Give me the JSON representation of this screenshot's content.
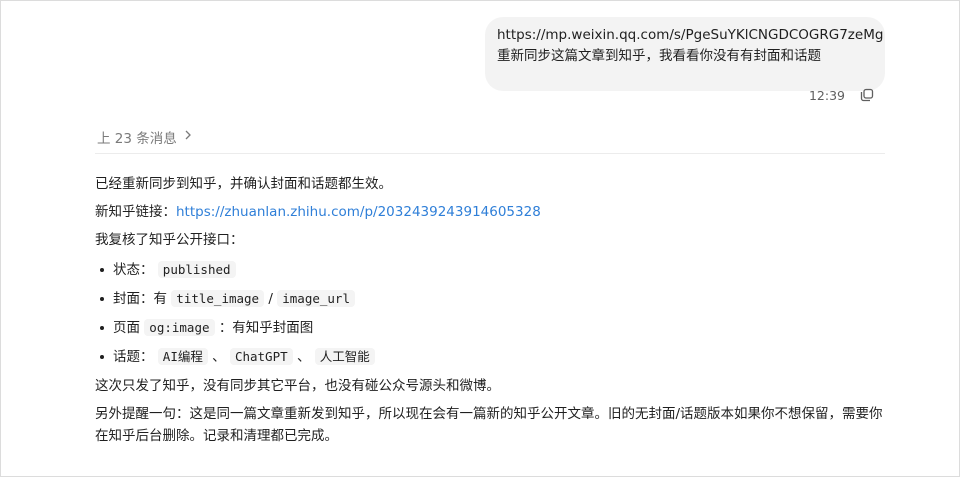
{
  "user_message": {
    "line1": "https://mp.weixin.qq.com/s/PgeSuYKlCNGDCOGRG7zeMg",
    "line2": "重新同步这篇文章到知乎，我看看你没有有封面和话题",
    "time": "12:39",
    "copy_icon": "copy-icon"
  },
  "history": {
    "label": "上 23 条消息",
    "chevron": "chevron-right-icon"
  },
  "reply": {
    "p1": "已经重新同步到知乎，并确认封面和话题都生效。",
    "link_label": "新知乎链接：",
    "link_url": "https://zhuanlan.zhihu.com/p/2032439243914605328",
    "p3": "我复核了知乎公开接口：",
    "facts": {
      "status_label": "状态：",
      "status_value": "published",
      "cover_label": "封面：有",
      "cover_code1": "title_image",
      "cover_sep": "/",
      "cover_code2": "image_url",
      "page_label": "页面",
      "page_code": "og:image",
      "page_suffix": "：有知乎封面图",
      "topic_label": "话题：",
      "topic1": "AI编程",
      "topic_sep": "、",
      "topic2": "ChatGPT",
      "topic3": "人工智能"
    },
    "p4": "这次只发了知乎，没有同步其它平台，也没有碰公众号源头和微博。",
    "p5": "另外提醒一句：这是同一篇文章重新发到知乎，所以现在会有一篇新的知乎公开文章。旧的无封面/话题版本如果你不想保留，需要你在知乎后台删除。记录和清理都已完成。"
  }
}
